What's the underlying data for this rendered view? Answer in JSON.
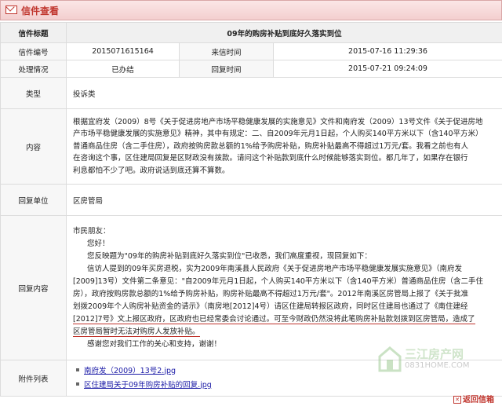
{
  "header": {
    "title": "信件查看",
    "icon": "mail-icon"
  },
  "letter": {
    "title_label": "信件标题",
    "title_value": "09年的购房补贴到底好久落实到位",
    "code_label": "信件编号",
    "code_value": "2015071615164",
    "arrive_label": "来信时间",
    "arrive_value": "2015-07-16 11:29:36",
    "status_label": "处理情况",
    "status_value": "已办结",
    "reply_time_label": "回复时间",
    "reply_time_value": "2015-07-21 09:24:09",
    "type_label": "类型",
    "type_value": "投诉类",
    "content_label": "内容",
    "content_lines": [
      "根据宜府发（2009）8号《关于促进房地产市场平稳健康发展的实施意见》文件和南府发（2009）13号文件《关于促进房地",
      "产市场平稳健康发展的实施意见》精神，其中有规定：二、自2009年元月1日起，个人购买140平方米以下（含140平方米）",
      "普通商品住房（含二手住房），政府按购房款总额的1%给予购房补贴，购房补贴最高不得超过1万元/套。我看之前也有人",
      "在咨询这个事，区住建局回复是区财政没有拨款。请问这个补贴款到底什么时候能够落实到位。都几年了，如果存在银行",
      "利息都怕不少了吧。政府说话到底还算不算数。"
    ],
    "reply_unit_label": "回复单位",
    "reply_unit_value": "区房管局",
    "reply_content_label": "回复内容",
    "reply_lines": [
      "市民朋友：",
      "您好！",
      "您反映题为\"09年的购房补贴到底好久落实到位\"已收悉，我们高度重视，现回复如下：",
      "信访人提到的09年买房退税，实为2009年南溪县人民政府《关于促进房地产市场平稳健康发展实施意见》（南府发",
      "[2009]13号）文件第二条意见：\"自2009年元月1日起，个人购买140平方米以下（含140平方米）普通商品住房（含二手住",
      "房），政府按购房款总额的1%给予购房补贴，购房补贴最高不得超过1万元/套\"。2012年南溪区房管局上报了《关于批准",
      "划拨2009年个人购房补贴资金的请示》（南房地[2012]4号）请区住建局转报区政府，同时区住建局也通过了《南住建经",
      "[2012]7号》文上报区政府，区政府也已经常委会讨论通过。可至今财政仍然没将此笔购房补贴款划拨到区房管局，造成了",
      "区房管局暂时无法对购房人发放补贴。",
      "感谢您对我们工作的关心和支持，谢谢！"
    ],
    "attachments_label": "附件列表",
    "attachments": [
      "南府发（2009）13号2.jpg",
      "区住建局关于09年购房补贴的回复.jpg"
    ]
  },
  "footer": {
    "back_label": "返回信箱"
  },
  "watermark": {
    "name": "三江房产网",
    "site": "0831HOME.COM"
  },
  "colors": {
    "accent": "#c0352d",
    "link": "#1a1aa6"
  }
}
